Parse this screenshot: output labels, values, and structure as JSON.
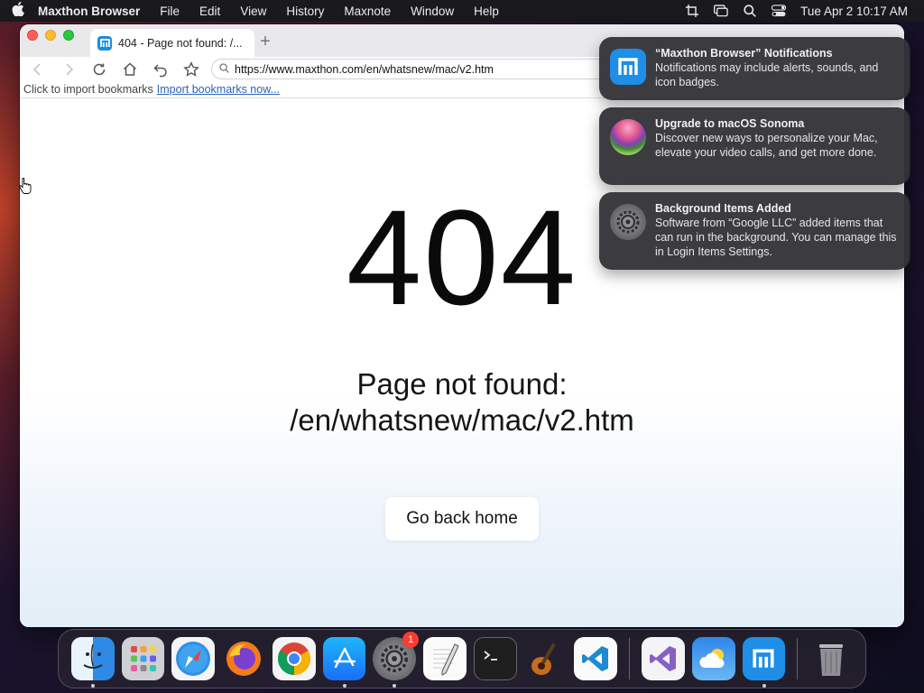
{
  "menubar": {
    "apple": "",
    "app_name": "Maxthon Browser",
    "items": [
      "File",
      "Edit",
      "View",
      "History",
      "Maxnote",
      "Window",
      "Help"
    ],
    "clock": "Tue Apr 2   10:17 AM",
    "status_icons": [
      "crop-icon",
      "screen-mirroring-icon",
      "search-icon",
      "control-center-icon"
    ]
  },
  "browser": {
    "tab_title": "404 - Page not found: /...",
    "new_tab": "+",
    "url": "https://www.maxthon.com/en/whatsnew/mac/v2.htm",
    "bookmarks_prompt": "Click to import bookmarks",
    "bookmarks_link": "Import bookmarks now..."
  },
  "page": {
    "error_code": "404",
    "message_line1": "Page not found:",
    "message_line2": "/en/whatsnew/mac/v2.htm",
    "home_button": "Go back home"
  },
  "notifications": [
    {
      "icon": "maxthon-icon",
      "title": "“Maxthon Browser” Notifications",
      "body": "Notifications may include alerts, sounds, and icon badges."
    },
    {
      "icon": "macos-sonoma-icon",
      "title": "Upgrade to macOS Sonoma",
      "body": "Discover new ways to personalize your Mac, elevate your video calls, and get more done."
    },
    {
      "icon": "system-settings-icon",
      "title": "Background Items Added",
      "body": "Software from “Google LLC” added items that can run in the background. You can manage this in Login Items Settings."
    }
  ],
  "dock": {
    "apps": [
      {
        "name": "finder-icon",
        "running": true
      },
      {
        "name": "launchpad-icon",
        "running": false
      },
      {
        "name": "safari-icon",
        "running": false
      },
      {
        "name": "firefox-icon",
        "running": false
      },
      {
        "name": "chrome-icon",
        "running": false
      },
      {
        "name": "app-store-icon",
        "running": true
      },
      {
        "name": "system-settings-icon",
        "running": true,
        "badge": "1"
      },
      {
        "name": "textedit-icon",
        "running": false
      },
      {
        "name": "terminal-icon",
        "running": false
      },
      {
        "name": "garageband-icon",
        "running": false
      },
      {
        "name": "vscode-icon",
        "running": false
      }
    ],
    "recent_apps": [
      {
        "name": "visual-studio-icon",
        "running": false
      },
      {
        "name": "weather-icon",
        "running": false
      },
      {
        "name": "maxthon-icon",
        "running": true
      }
    ],
    "trash": {
      "name": "trash-icon"
    }
  }
}
